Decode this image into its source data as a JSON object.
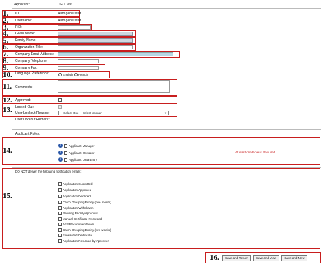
{
  "header": {
    "label": "Applicant:",
    "value": "DFO Test"
  },
  "callouts": [
    "1.",
    "2.",
    "3.",
    "4.",
    "5.",
    "6.",
    "7.",
    "8.",
    "9.",
    "10.",
    "11.",
    "12.",
    "13.",
    "14.",
    "15.",
    "16."
  ],
  "fields": {
    "id": {
      "label": "ID:",
      "value": "Auto generated"
    },
    "username": {
      "label": "Username:",
      "value": "Auto generated"
    },
    "pid": {
      "label": "PID:"
    },
    "given_name": {
      "label": "Given Name:"
    },
    "family_name": {
      "label": "Family Name:"
    },
    "org_title": {
      "label": "Organization Title:"
    },
    "company_email": {
      "label": "Company Email Address:"
    },
    "company_phone": {
      "label": "Company Telephone:"
    },
    "company_fax": {
      "label": "Company Fax:"
    },
    "language": {
      "label": "Language Preference:",
      "options": [
        "English",
        "French"
      ]
    },
    "comments": {
      "label": "Comments:"
    },
    "approved": {
      "label": "Approved:"
    },
    "locked_out": {
      "label": "Locked Out:"
    },
    "lockout_reason": {
      "label": "User Lockout Reason:",
      "selected": "-- Select One -- Select-conner --"
    },
    "lockout_remark": {
      "label": "User Lockout Remark:"
    }
  },
  "roles": {
    "title": "Applicant Roles:",
    "items": [
      "Applicant Manager",
      "Applicant Operator",
      "Applicant Data Entry"
    ],
    "warning": "At least one Role is Required"
  },
  "notifications": {
    "title": "DO NOT deliver the following notification emails:",
    "items": [
      "Application Submitted",
      "Application Approved",
      "Application Declined",
      "Catch Grouping Expiry (one month)",
      "Application Withdrawn",
      "Pending Priority Approval",
      "Manual Certificate Recorded",
      "AFP Recommendation",
      "Catch Grouping Expiry (two weeks)",
      "Forwarded Certificate",
      "Application Returned by Approver"
    ]
  },
  "buttons": {
    "save_return": "Save and Return",
    "save_view": "Save and View",
    "save_new": "Save and New"
  },
  "colors": {
    "callout_border": "#c81e1e",
    "required_text": "#c81e1e",
    "input_blue": "#b7d7e4",
    "info_icon": "#2a57a8"
  }
}
